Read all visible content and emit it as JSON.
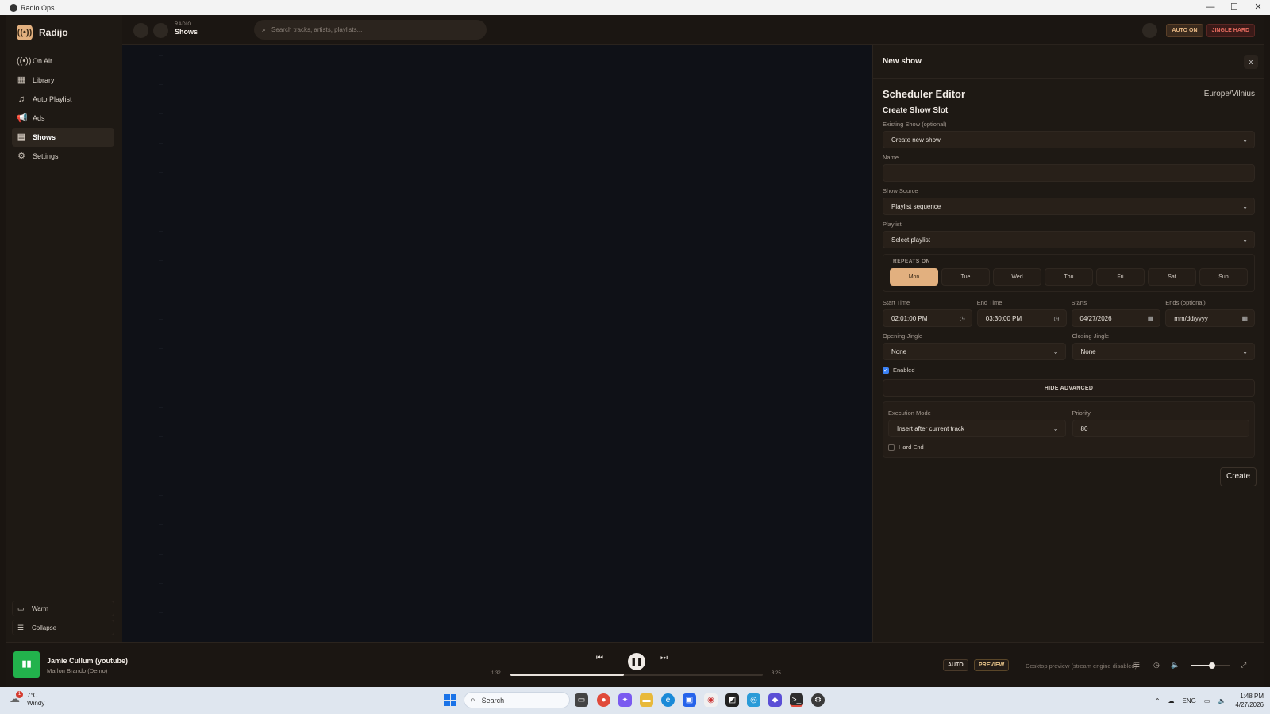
{
  "window": {
    "title": "Radio Ops",
    "controls": [
      "—",
      "☐",
      "✕"
    ]
  },
  "brand": {
    "name": "Radijo",
    "logo_icon": "broadcast-icon"
  },
  "nav": [
    {
      "label": "On Air",
      "icon": "broadcast-icon",
      "glyph": "((•))"
    },
    {
      "label": "Library",
      "icon": "grid-icon",
      "glyph": "▦"
    },
    {
      "label": "Auto Playlist",
      "icon": "music-note-icon",
      "glyph": "♫"
    },
    {
      "label": "Ads",
      "icon": "megaphone-icon",
      "glyph": "📢"
    },
    {
      "label": "Shows",
      "icon": "calendar-icon",
      "glyph": "▤",
      "active": true
    },
    {
      "label": "Settings",
      "icon": "gear-icon",
      "glyph": "⚙"
    }
  ],
  "sidebar_bottom": {
    "theme_label": "Warm",
    "collapse_label": "Collapse"
  },
  "header": {
    "crumb_small": "RADIO",
    "crumb_big": "Shows",
    "search_placeholder": "Search tracks, artists, playlists...",
    "auto_label": "AUTO ON",
    "jingle_label": "JINGLE HARD"
  },
  "panel": {
    "head_title": "New show",
    "close_label": "x",
    "editor_title": "Scheduler Editor",
    "timezone": "Europe/Vilnius",
    "section_title": "Create Show Slot",
    "existing_show": {
      "label": "Existing Show (optional)",
      "value": "Create new show"
    },
    "name": {
      "label": "Name",
      "value": ""
    },
    "show_source": {
      "label": "Show Source",
      "value": "Playlist sequence"
    },
    "playlist": {
      "label": "Playlist",
      "value": "Select playlist"
    },
    "repeats": {
      "label": "REPEATS ON",
      "days": [
        "Mon",
        "Tue",
        "Wed",
        "Thu",
        "Fri",
        "Sat",
        "Sun"
      ],
      "selected": "Mon"
    },
    "start_time": {
      "label": "Start Time",
      "value": "02:01:00 PM"
    },
    "end_time": {
      "label": "End Time",
      "value": "03:30:00 PM"
    },
    "starts": {
      "label": "Starts",
      "value": "04/27/2026"
    },
    "ends": {
      "label": "Ends (optional)",
      "value": "mm/dd/yyyy"
    },
    "opening_jingle": {
      "label": "Opening Jingle",
      "value": "None"
    },
    "closing_jingle": {
      "label": "Closing Jingle",
      "value": "None"
    },
    "enabled": {
      "label": "Enabled",
      "checked": true
    },
    "advanced_toggle": "HIDE ADVANCED",
    "execution_mode": {
      "label": "Execution Mode",
      "value": "Insert after current track"
    },
    "priority": {
      "label": "Priority",
      "value": "80"
    },
    "hard_end": {
      "label": "Hard End",
      "checked": false
    },
    "create_label": "Create"
  },
  "player": {
    "title": "Jamie Cullum (youtube)",
    "artist": "Marlon Brando (Demo)",
    "elapsed": "1:32",
    "duration": "3:25",
    "progress_fraction": 0.45,
    "auto_label": "AUTO",
    "preview_label": "PREVIEW",
    "preview_note": "Desktop preview (stream engine disabled)",
    "volume_fraction": 0.55
  },
  "taskbar": {
    "weather_temp": "7°C",
    "weather_desc": "Windy",
    "weather_badge": "1",
    "search_label": "Search",
    "lang": "ENG",
    "time": "1:48 PM",
    "date": "4/27/2026"
  },
  "colors": {
    "accent": "#e2b07f",
    "jingle": "#e46a5e",
    "play_art": "#22b24c",
    "checkbox": "#3b82f6"
  }
}
